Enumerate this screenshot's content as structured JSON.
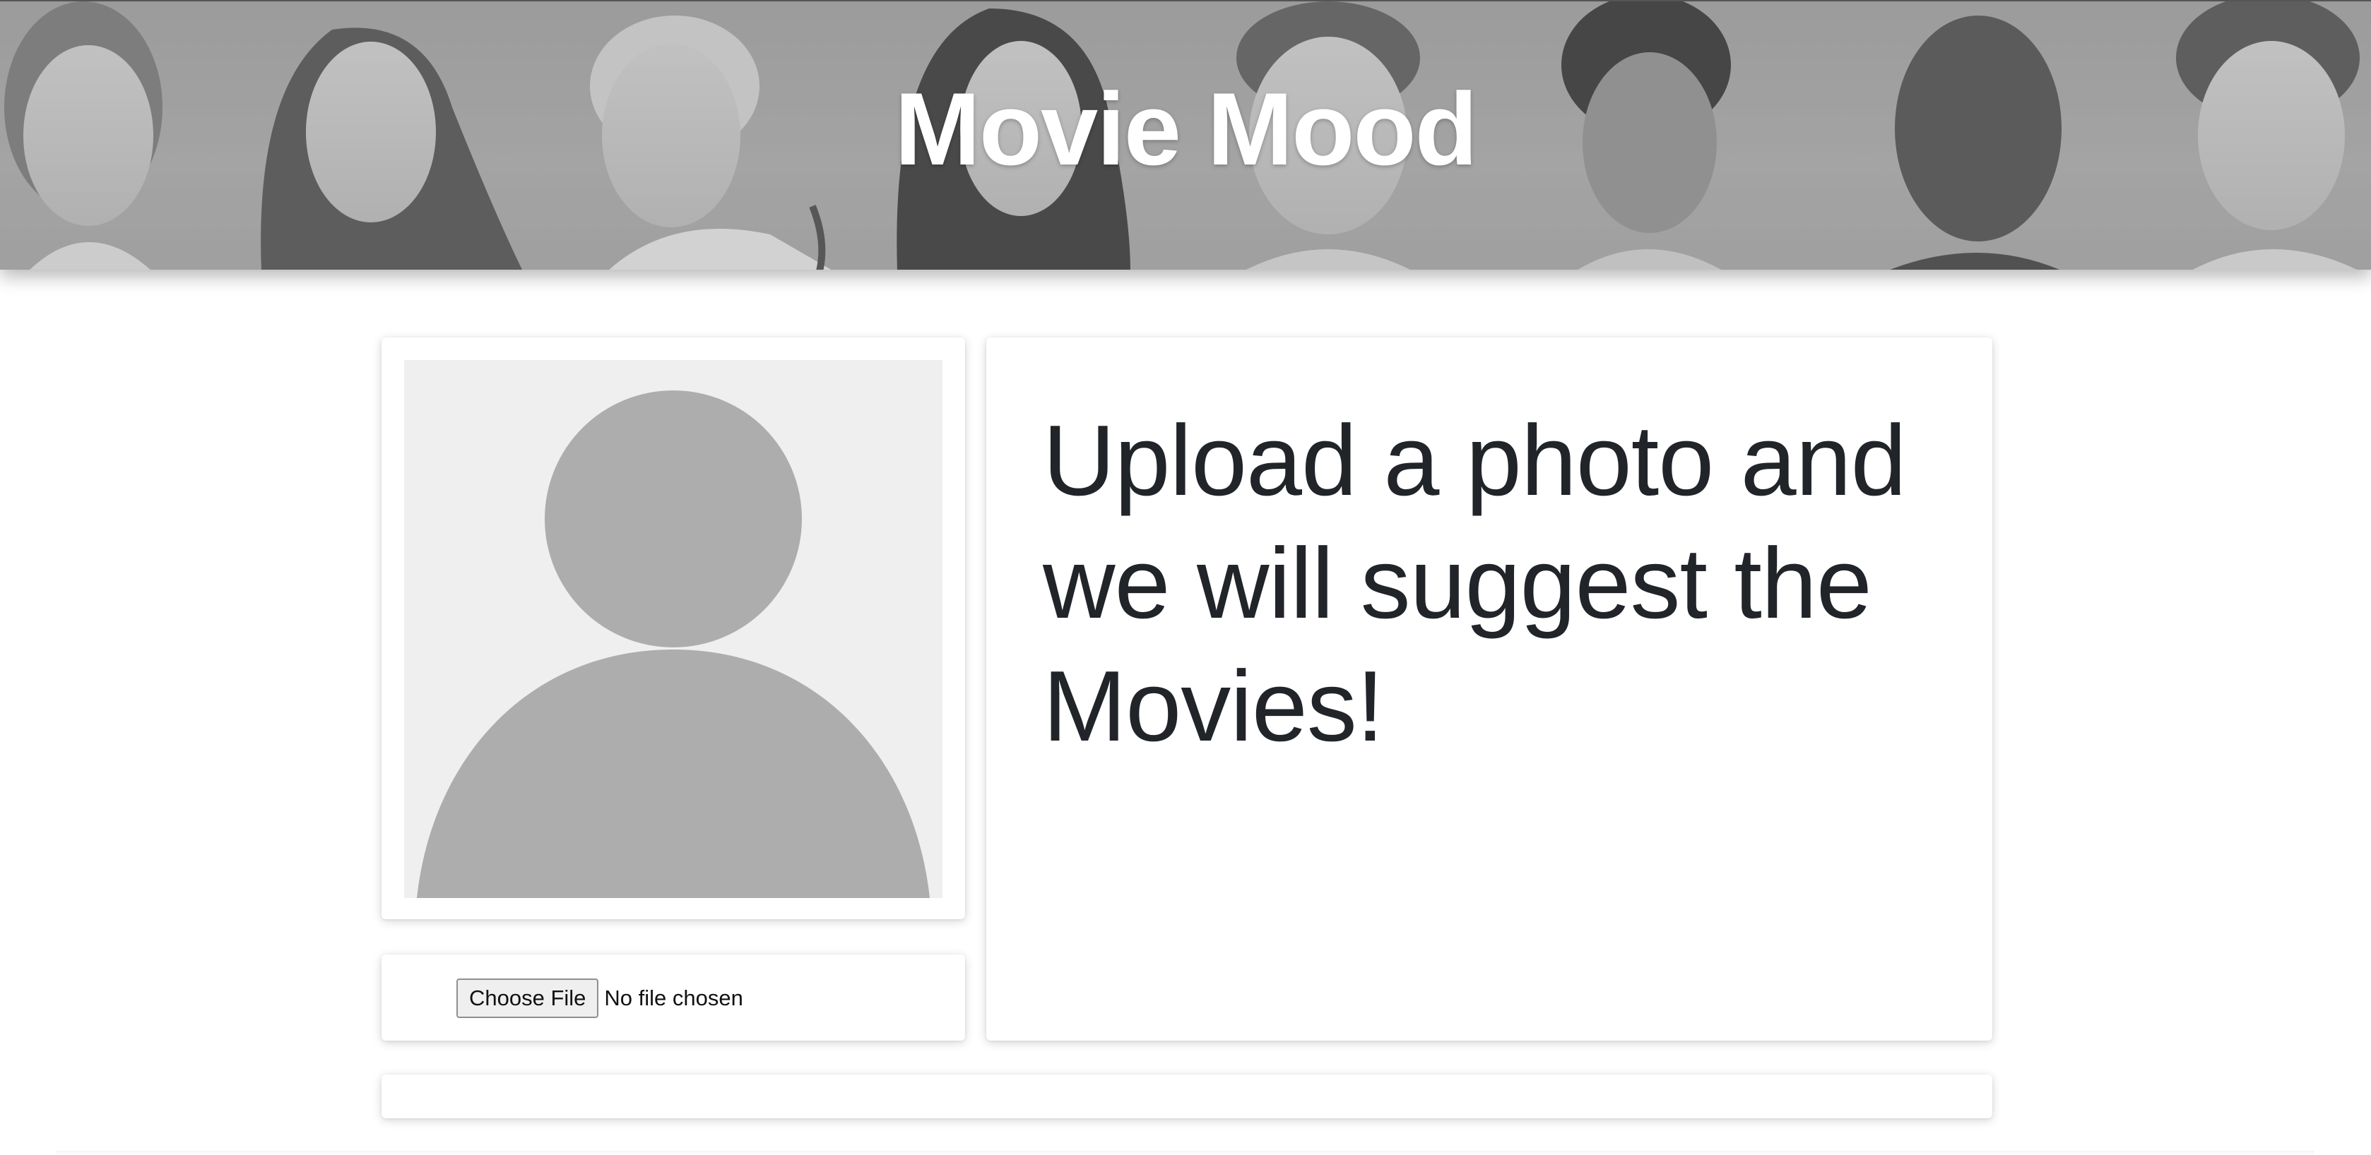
{
  "header": {
    "title": "Movie Mood"
  },
  "photo_panel": {
    "placeholder_icon": "avatar-placeholder-icon"
  },
  "upload": {
    "button_label": "Choose File",
    "status_text": "No file chosen"
  },
  "main": {
    "headline": "Upload a photo and we will suggest the Movies!"
  },
  "colors": {
    "banner_gray": "#a6a6a6",
    "title_text": "#ffffff",
    "headline_text": "#212529",
    "placeholder_bg": "#efefef",
    "placeholder_figure": "#adadad"
  }
}
